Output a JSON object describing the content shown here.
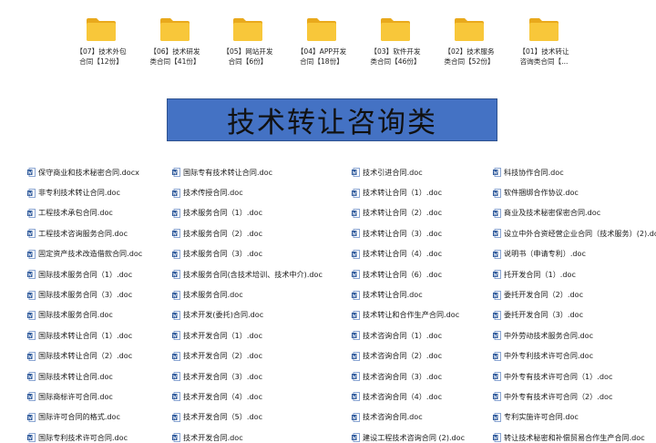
{
  "folders": [
    {
      "line1": "【07】技术外包",
      "line2": "合同【12份】"
    },
    {
      "line1": "【06】技术研发",
      "line2": "类合同【41份】"
    },
    {
      "line1": "【05】网站开发",
      "line2": "合同【6份】"
    },
    {
      "line1": "【04】APP开发",
      "line2": "合同【18份】"
    },
    {
      "line1": "【03】软件开发",
      "line2": "类合同【46份】"
    },
    {
      "line1": "【02】技术服务",
      "line2": "类合同【52份】"
    },
    {
      "line1": "【01】技术转让",
      "line2": "咨询类合同【..."
    }
  ],
  "banner": {
    "title": "技术转让咨询类"
  },
  "columns": [
    [
      "保守商业和技术秘密合同.docx",
      "非专利技术转让合同.doc",
      "工程技术承包合同.doc",
      "工程技术咨询服务合同.doc",
      "固定资产技术改造借款合同.doc",
      "国际技术服务合同（1）.doc",
      "国际技术服务合同（3）.doc",
      "国际技术服务合同.doc",
      "国际技术转让合同（1）.doc",
      "国际技术转让合同（2）.doc",
      "国际技术转让合同.doc",
      "国际商标许可合同.doc",
      "国际许可合同的格式.doc",
      "国际专利技术许可合同.doc"
    ],
    [
      "国际专有技术转让合同.doc",
      "技术传授合同.doc",
      "技术服务合同（1）.doc",
      "技术服务合同（2）.doc",
      "技术服务合同（3）.doc",
      "技术服务合同(含技术培训、技术中介).doc",
      "技术服务合同.doc",
      "技术开发(委托)合同.doc",
      "技术开发合同（1）.doc",
      "技术开发合同（2）.doc",
      "技术开发合同（3）.doc",
      "技术开发合同（4）.doc",
      "技术开发合同（5）.doc",
      "技术开发合同.doc"
    ],
    [
      "技术引进合同.doc",
      "技术转让合同（1）.doc",
      "技术转让合同（2）.doc",
      "技术转让合同（3）.doc",
      "技术转让合同（4）.doc",
      "技术转让合同（6）.doc",
      "技术转让合同.doc",
      "技术转让和合作生产合同.doc",
      "技术咨询合同（1）.doc",
      "技术咨询合同（2）.doc",
      "技术咨询合同（3）.doc",
      "技术咨询合同（4）.doc",
      "技术咨询合同.doc",
      "建设工程技术咨询合同 (2).doc"
    ],
    [
      "科技协作合同.doc",
      "软件捆绑合作协议.doc",
      "商业及技术秘密保密合同.doc",
      "设立中外合资经营企业合同（技术服务）(2).doc",
      "说明书（申请专利）.doc",
      "托开发合同（1）.doc",
      "委托开发合同（2）.doc",
      "委托开发合同（3）.doc",
      "中外劳动技术服务合同.doc",
      "中外专利技术许可合同.doc",
      "中外专有技术许可合同（1）.doc",
      "中外专有技术许可合同（2）.doc",
      "专利实施许可合同.doc",
      "转让技术秘密和补偿贸易合作生产合同.doc"
    ]
  ],
  "colors": {
    "banner": "#4472c4",
    "folder": "#f5c02c",
    "doc_icon": "#2b579a"
  }
}
